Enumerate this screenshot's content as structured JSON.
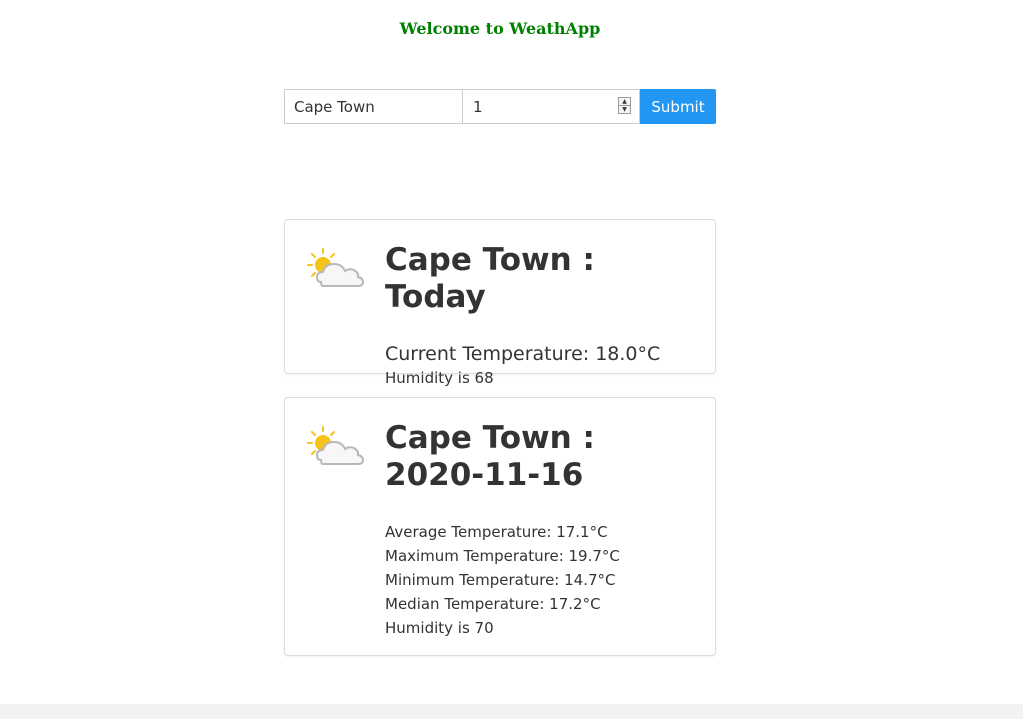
{
  "header": {
    "welcome_text": "Welcome to WeathApp"
  },
  "search": {
    "city_value": "Cape Town",
    "days_value": "1",
    "submit_label": "Submit"
  },
  "today_card": {
    "title": "Cape Town : Today",
    "icon": "partly-cloudy-icon",
    "current_temperature": "Current Temperature: 18.0°C",
    "humidity": "Humidity is 68"
  },
  "forecast_card": {
    "title_line1": "Cape Town :",
    "title_line2": "2020-11-16",
    "icon": "partly-cloudy-icon",
    "average_temperature": "Average Temperature: 17.1°C",
    "maximum_temperature": "Maximum Temperature: 19.7°C",
    "minimum_temperature": "Minimum Temperature: 14.7°C",
    "median_temperature": "Median Temperature: 17.2°C",
    "humidity": "Humidity is 70"
  },
  "colors": {
    "welcome": "#008000",
    "submit_background": "#2196f3",
    "sun": "#f6c21c",
    "cloud_stroke": "#b8b8b8"
  }
}
